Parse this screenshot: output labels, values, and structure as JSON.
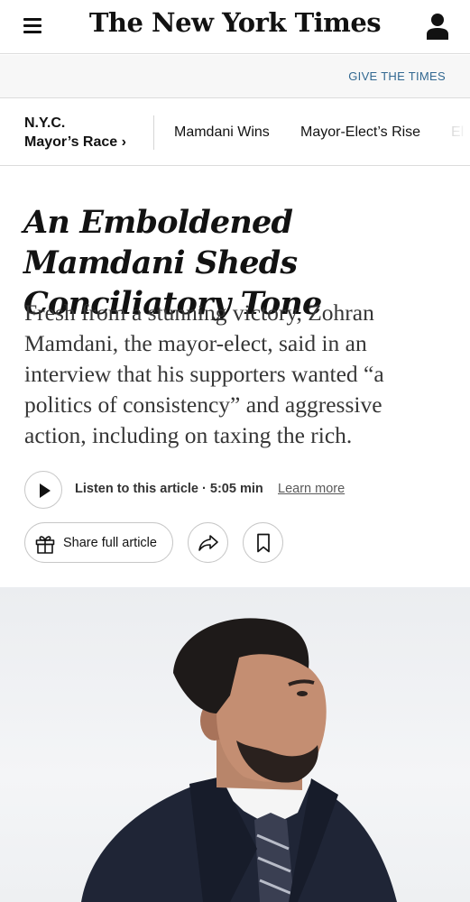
{
  "header": {
    "logo_text": "The New York Times",
    "menu_icon": "hamburger-menu-icon",
    "account_icon": "user-account-icon"
  },
  "promo": {
    "give_label": "GIVE THE TIMES",
    "link_color": "#326891"
  },
  "section_nav": {
    "section_line1": "N.Y.C.",
    "section_line2": "Mayor’s Race ›",
    "links": [
      "Mamdani Wins",
      "Mayor-Elect’s Rise",
      "El"
    ]
  },
  "article": {
    "headline": "An Emboldened Mamdani Sheds Conciliatory Tone",
    "summary": "Fresh from a stunning victory, Zohran Mamdani, the mayor-elect, said in an interview that his supporters wanted “a politics of consistency” and aggressive action, including on taxing the rich."
  },
  "audio": {
    "play_icon": "play-icon",
    "listen_label": "Listen to this article",
    "separator": "·",
    "duration": "5:05 min",
    "learn_more": "Learn more"
  },
  "actions": {
    "share_label": "Share full article",
    "gift_icon": "gift-icon",
    "share_icon": "share-arrow-icon",
    "bookmark_icon": "bookmark-icon"
  },
  "image": {
    "subject": "lead-photo-mayor-elect"
  }
}
